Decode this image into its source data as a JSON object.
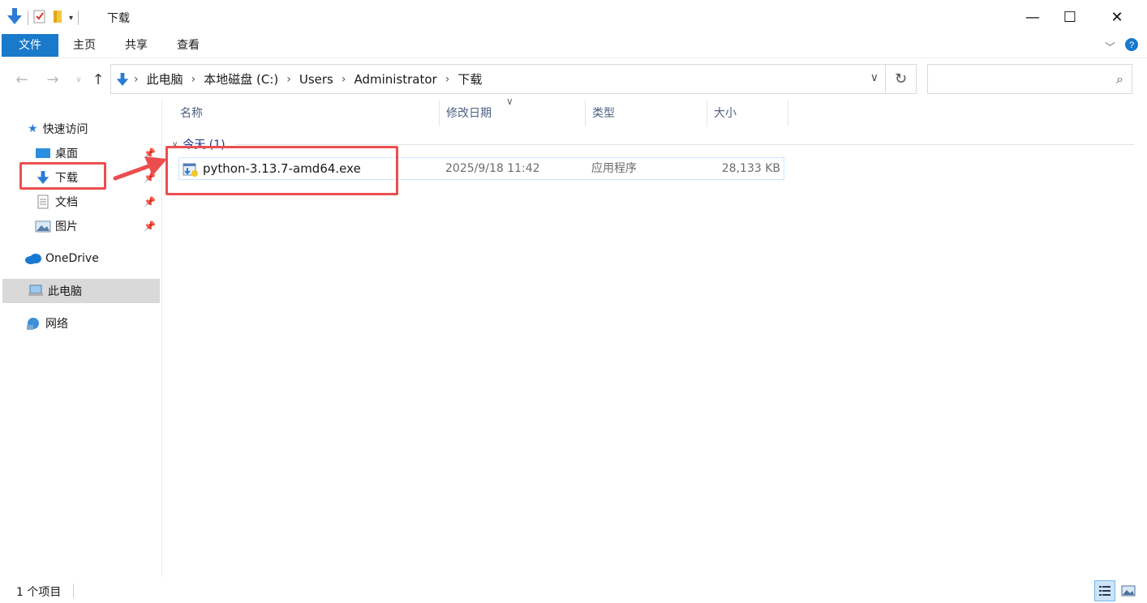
{
  "window": {
    "title": "下载",
    "controls": {
      "minimize": "—",
      "maximize": "☐",
      "close": "✕"
    }
  },
  "ribbon": {
    "tabs": [
      "文件",
      "主页",
      "共享",
      "查看"
    ]
  },
  "address_bar": {
    "crumbs": [
      "此电脑",
      "本地磁盘 (C:)",
      "Users",
      "Administrator",
      "下载"
    ]
  },
  "search": {
    "placeholder": ""
  },
  "nav_pane": {
    "quick_access": "快速访问",
    "items": [
      {
        "label": "桌面",
        "icon": "desktop-icon",
        "pinned": true
      },
      {
        "label": "下载",
        "icon": "download-arrow-icon",
        "pinned": true
      },
      {
        "label": "文档",
        "icon": "document-icon",
        "pinned": true
      },
      {
        "label": "图片",
        "icon": "pictures-icon",
        "pinned": true
      }
    ],
    "onedrive": "OneDrive",
    "this_pc": "此电脑",
    "network": "网络"
  },
  "file_list": {
    "columns": [
      "名称",
      "修改日期",
      "类型",
      "大小"
    ],
    "group_label": "今天 (1)",
    "rows": [
      {
        "name": "python-3.13.7-amd64.exe",
        "modified": "2025/9/18 11:42",
        "type": "应用程序",
        "size": "28,133 KB"
      }
    ]
  },
  "status_bar": {
    "count": "1 个项目"
  },
  "colors": {
    "accent": "#1979ca",
    "annotation": "#ec4e4e",
    "folder_blue": "#2b7cd3"
  }
}
